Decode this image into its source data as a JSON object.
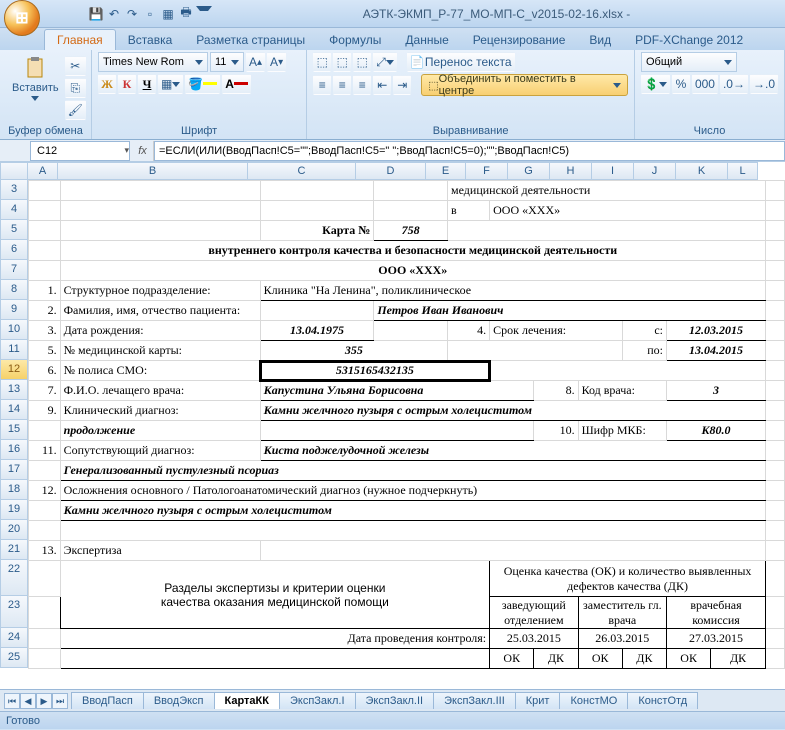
{
  "titlebar": {
    "filename": "АЭТК-ЭКМП_Р-77_МО-МП-C_v2015-02-16.xlsx -"
  },
  "qat_icons": [
    "save",
    "undo",
    "redo",
    "new",
    "print-area",
    "quick-print"
  ],
  "ribbon_tabs": [
    "Главная",
    "Вставка",
    "Разметка страницы",
    "Формулы",
    "Данные",
    "Рецензирование",
    "Вид",
    "PDF-XChange 2012"
  ],
  "active_tab_index": 0,
  "clipboard": {
    "paste": "Вставить",
    "group": "Буфер обмена"
  },
  "font": {
    "name": "Times New Rom",
    "size": "11",
    "btn_bold": "Ж",
    "btn_italic": "К",
    "btn_under": "Ч",
    "group": "Шрифт"
  },
  "align": {
    "wrap": "Перенос текста",
    "merge": "Объединить и поместить в центре",
    "group": "Выравнивание"
  },
  "number": {
    "format": "Общий",
    "group": "Число"
  },
  "namebox": "C12",
  "formula": "=ЕСЛИ(ИЛИ(ВводПасп!C5=\"\";ВводПасп!C5=\" \";ВводПасп!C5=0);\"\";ВводПасп!C5)",
  "cols": [
    "A",
    "B",
    "C",
    "D",
    "E",
    "F",
    "G",
    "H",
    "I",
    "J",
    "K",
    "L"
  ],
  "rows": [
    "3",
    "4",
    "5",
    "6",
    "7",
    "8",
    "9",
    "10",
    "11",
    "12",
    "13",
    "14",
    "15",
    "16",
    "17",
    "18",
    "19",
    "20",
    "21",
    "22",
    "23",
    "24",
    "25"
  ],
  "selected_row": "12",
  "doc": {
    "line3": "медицинской деятельности",
    "line4_pre": "в",
    "line4_org": "ООО «XXX»",
    "card_lbl": "Карта №",
    "card_no": "758",
    "line6": "внутреннего контроля качества и безопасности медицинской деятельности",
    "line7": "ООО «XXX»",
    "n1": "1.",
    "f1": "Структурное подразделение:",
    "v1": "Клиника \"На Ленина\", поликлиническое",
    "n2": "2.",
    "f2": "Фамилия, имя, отчество пациента:",
    "v2": "Петров Иван Иванович",
    "n3": "3.",
    "f3": "Дата рождения:",
    "v3": "13.04.1975",
    "n4": "4.",
    "f4": "Срок лечения:",
    "f4s": "с:",
    "v4s": "12.03.2015",
    "n5": "5.",
    "f5": "№ медицинской карты:",
    "v5": "355",
    "f5p": "по:",
    "v5p": "13.04.2015",
    "n6": "6.",
    "f6": "№ полиса СМО:",
    "v6": "5315165432135",
    "n7": "7.",
    "f7": "Ф.И.О. лечащего врача:",
    "v7": "Капустина Ульяна Борисовна",
    "n8": "8.",
    "f8": "Код врача:",
    "v8": "3",
    "n9": "9.",
    "f9": "Клинический диагноз:",
    "v9": "Камни желчного пузыря с острым холециститом",
    "cont": "продолжение",
    "n10": "10.",
    "f10": "Шифр МКБ:",
    "v10": "K80.0",
    "n11": "11.",
    "f11": "Сопутствующий диагноз:",
    "v11": "Киста поджелудочной железы",
    "l17": "Генерализованный пустулезный псориаз",
    "n12": "12.",
    "f12": "Осложнения основного / Патологоанатомический диагноз (нужное подчеркнуть)",
    "l19": "Камни желчного пузыря с острым холециститом",
    "n13": "13.",
    "f13": "Экспертиза",
    "tbl": {
      "h1a": "Разделы экспертизы и критерии оценки",
      "h1b": "качества оказания медицинской помощи",
      "h2": "Оценка качества (ОК) и количество выявленных дефектов качества (ДК)",
      "c1": "заведующий отделением",
      "c2": "заместитель гл. врача",
      "c3": "врачебная комиссия",
      "ctrl": "Дата проведения контроля:",
      "d1": "25.03.2015",
      "d2": "26.03.2015",
      "d3": "27.03.2015",
      "ok": "ОК",
      "dk": "ДК"
    }
  },
  "sheet_tabs": [
    "ВводПасп",
    "ВводЭксп",
    "КартаКК",
    "ЭкспЗакл.I",
    "ЭкспЗакл.II",
    "ЭкспЗакл.III",
    "Крит",
    "КонстМО",
    "КонстОтд"
  ],
  "active_sheet_index": 2,
  "status": "Готово"
}
